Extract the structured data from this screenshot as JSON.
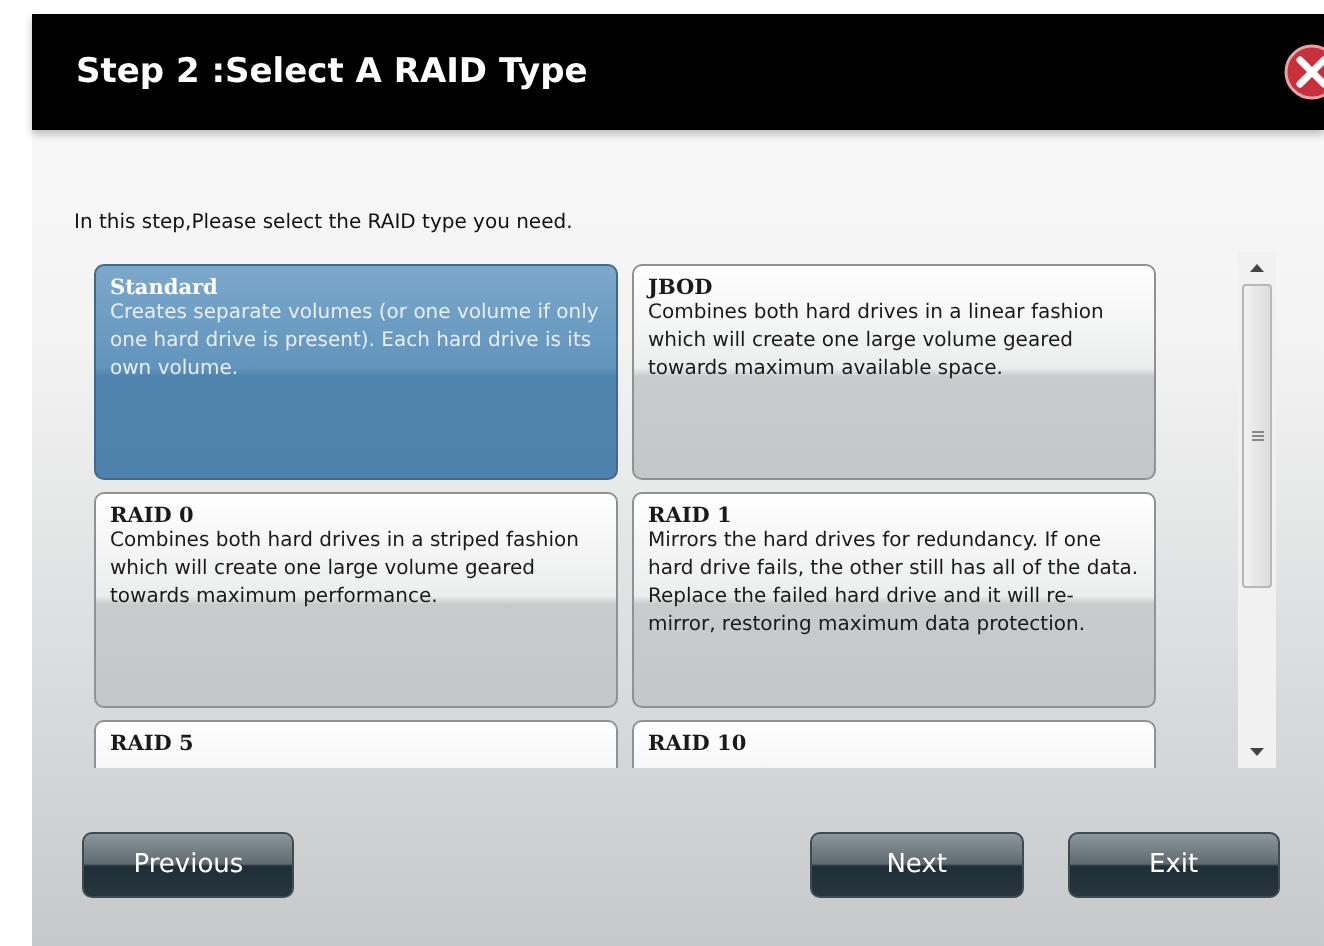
{
  "dialog": {
    "title": "Step 2 :Select A RAID Type"
  },
  "instruction": "In this step,Please select the RAID type you need.",
  "raid_types": [
    {
      "name": "Standard",
      "description": "Creates separate volumes (or one volume if only one hard drive is present). Each hard drive is its own volume.",
      "selected": true
    },
    {
      "name": "JBOD",
      "description": "Combines both hard drives in a linear fashion which will create one large volume geared towards maximum available space.",
      "selected": false
    },
    {
      "name": "RAID 0",
      "description": "Combines both hard drives in a striped fashion which will create one large volume geared towards maximum performance.",
      "selected": false
    },
    {
      "name": "RAID 1",
      "description": "Mirrors the hard drives for redundancy. If one hard drive fails, the other still has all of the data. Replace the failed hard drive and it will re-mirror, restoring maximum data protection.",
      "selected": false
    },
    {
      "name": "RAID 5",
      "selected": false
    },
    {
      "name": "RAID 10",
      "selected": false
    }
  ],
  "buttons": {
    "previous": "Previous",
    "next": "Next",
    "exit": "Exit"
  }
}
